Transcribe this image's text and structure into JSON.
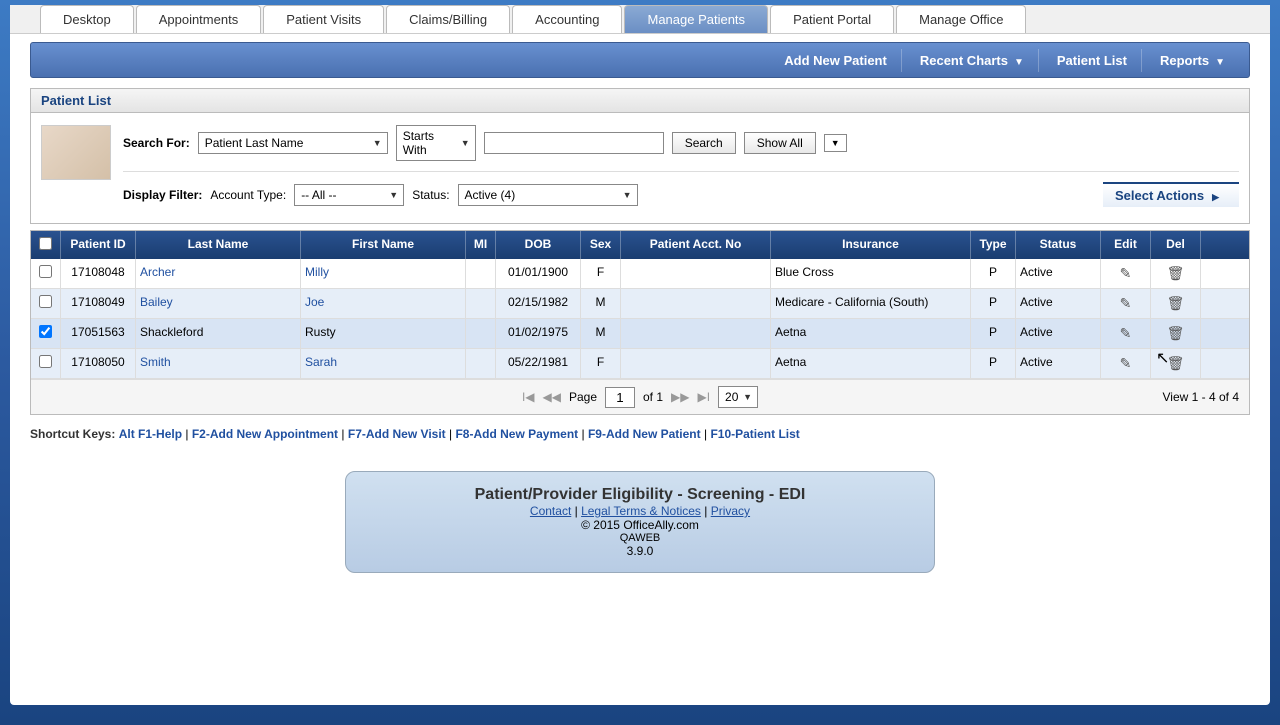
{
  "tabs": [
    "Desktop",
    "Appointments",
    "Patient Visits",
    "Claims/Billing",
    "Accounting",
    "Manage Patients",
    "Patient Portal",
    "Manage Office"
  ],
  "active_tab": 5,
  "toolbar": {
    "add_patient": "Add New Patient",
    "recent_charts": "Recent Charts",
    "patient_list": "Patient List",
    "reports": "Reports"
  },
  "panel_title": "Patient List",
  "search": {
    "label": "Search For:",
    "field_select": "Patient Last Name",
    "match_select": "Starts With",
    "input_value": "",
    "search_btn": "Search",
    "show_all_btn": "Show All"
  },
  "filter": {
    "label": "Display Filter:",
    "acct_label": "Account Type:",
    "acct_value": "-- All --",
    "status_label": "Status:",
    "status_value": "Active (4)",
    "select_actions": "Select Actions"
  },
  "columns": [
    "",
    "Patient ID",
    "Last Name",
    "First Name",
    "MI",
    "DOB",
    "Sex",
    "Patient Acct. No",
    "Insurance",
    "Type",
    "Status",
    "Edit",
    "Del"
  ],
  "rows": [
    {
      "checked": false,
      "id": "17108048",
      "last": "Archer",
      "first": "Milly",
      "mi": "",
      "dob": "01/01/1900",
      "sex": "F",
      "acct": "",
      "ins": "Blue Cross",
      "type": "P",
      "status": "Active",
      "link": true
    },
    {
      "checked": false,
      "id": "17108049",
      "last": "Bailey",
      "first": "Joe",
      "mi": "",
      "dob": "02/15/1982",
      "sex": "M",
      "acct": "",
      "ins": "Medicare - California (South)",
      "type": "P",
      "status": "Active",
      "link": true
    },
    {
      "checked": true,
      "id": "17051563",
      "last": "Shackleford",
      "first": "Rusty",
      "mi": "",
      "dob": "01/02/1975",
      "sex": "M",
      "acct": "",
      "ins": "Aetna",
      "type": "P",
      "status": "Active",
      "link": false
    },
    {
      "checked": false,
      "id": "17108050",
      "last": "Smith",
      "first": "Sarah",
      "mi": "",
      "dob": "05/22/1981",
      "sex": "F",
      "acct": "",
      "ins": "Aetna",
      "type": "P",
      "status": "Active",
      "link": true
    }
  ],
  "pager": {
    "page_label": "Page",
    "page_value": "1",
    "of_label": "of 1",
    "per_page": "20",
    "view_text": "View 1 - 4 of 4"
  },
  "shortcuts": {
    "label": "Shortcut Keys:",
    "items": [
      "Alt F1-Help",
      "F2-Add New Appointment",
      "F7-Add New Visit",
      "F8-Add New Payment",
      "F9-Add New Patient",
      "F10-Patient List"
    ]
  },
  "footer": {
    "title": "Patient/Provider Eligibility - Screening - EDI",
    "contact": "Contact",
    "legal": "Legal Terms & Notices",
    "privacy": "Privacy",
    "copyright": "© 2015 OfficeAlly.com",
    "server": "QAWEB",
    "version": "3.9.0"
  }
}
